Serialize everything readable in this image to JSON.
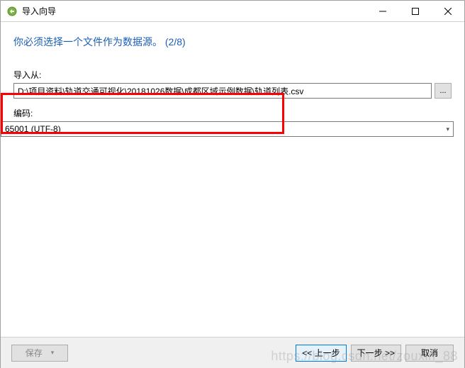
{
  "window": {
    "title": "导入向导"
  },
  "instruction": "你必须选择一个文件作为数据源。 (2/8)",
  "labels": {
    "import_from": "导入从:",
    "encoding": "编码:"
  },
  "fields": {
    "import_path": "D:\\项目资料\\轨道交通可视化\\20181026数据\\成都区域示例数据\\轨道列表.csv",
    "encoding_value": "65001 (UTF-8)"
  },
  "buttons": {
    "browse": "...",
    "save": "保存",
    "prev": "<< 上一步",
    "next": "下一步 >>",
    "cancel": "取消"
  },
  "watermark": "https://blog.csdn.net/zouxin_88"
}
